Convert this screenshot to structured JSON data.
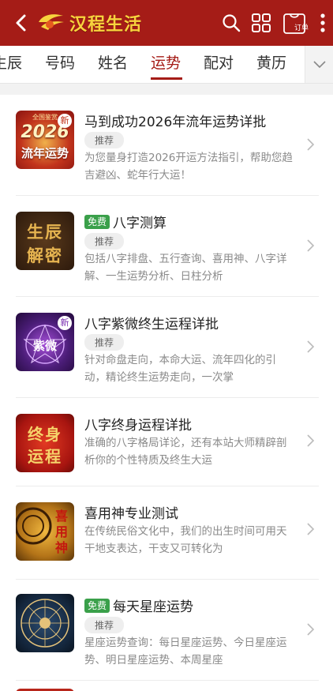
{
  "header": {
    "app_name": "汉程生活",
    "order_label": "订单",
    "brand_color": "#a51c17",
    "logo_color": "#f7d33d"
  },
  "tabs": [
    {
      "label": "生辰",
      "active": false
    },
    {
      "label": "号码",
      "active": false
    },
    {
      "label": "姓名",
      "active": false
    },
    {
      "label": "运势",
      "active": true
    },
    {
      "label": "配对",
      "active": false
    },
    {
      "label": "黄历",
      "active": false
    }
  ],
  "items": [
    {
      "title": "马到成功2026年流年运势详批",
      "free": "",
      "tag": "推荐",
      "desc": "为您量身打造2026开运方法指引，帮助您趋吉避凶、蛇年行大运！",
      "thumb_text_1": "2026",
      "thumb_text_2": "流年运势",
      "thumb_badge": "新",
      "thumb_top": "全国鉴赏"
    },
    {
      "title": "八字测算",
      "free": "免费",
      "tag": "推荐",
      "desc": "包括八字排盘、五行查询、喜用神、八字详解、一生运势分析、日柱分析",
      "thumb_text_1": "生辰",
      "thumb_text_2": "解密"
    },
    {
      "title": "八字紫微终生运程详批",
      "free": "",
      "tag": "推荐",
      "desc": "针对命盘走向，本命大运、流年四化的引动，精论终生运势走向，一次掌",
      "thumb_text_1": "紫微",
      "thumb_badge": "新"
    },
    {
      "title": "八字终身运程详批",
      "free": "",
      "tag": "",
      "desc": "准确的八字格局详论，还有本站大师精辟剖析你的个性特质及终生大运",
      "thumb_text_1": "终身",
      "thumb_text_2": "运程"
    },
    {
      "title": "喜用神专业测试",
      "free": "",
      "tag": "",
      "desc": "在传统民俗文化中，我们的出生时间可用天干地支表达，干支又可转化为",
      "thumb_text_1": "喜用神"
    },
    {
      "title": "每天星座运势",
      "free": "免费",
      "tag": "推荐",
      "desc": "星座运势查询：每日星座运势、今日星座运势、明日星座运势、本周星座"
    }
  ]
}
